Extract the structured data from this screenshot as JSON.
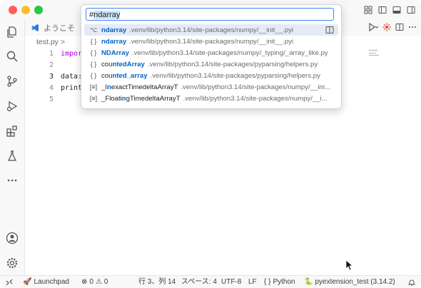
{
  "editor_tabs": [
    {
      "label": "ようこそ",
      "icon": "vscode-logo-icon"
    }
  ],
  "breadcrumb": {
    "file": "test.py",
    "separator": ">"
  },
  "code": {
    "lines": [
      {
        "num": "1",
        "text": "impor"
      },
      {
        "num": "2",
        "text": ""
      },
      {
        "num": "3",
        "text": "data:"
      },
      {
        "num": "4",
        "text": "print"
      },
      {
        "num": "5",
        "text": ""
      }
    ]
  },
  "quick_open": {
    "input": {
      "prefix": "#",
      "selected": "ndarray"
    },
    "results": [
      {
        "icon": "alias-icon",
        "icon_glyph": "⌥",
        "name_pre": "",
        "name_hl": "ndarray",
        "name_post": "",
        "path": ".venv/lib/python3.14/site-packages/numpy/__init__.pyi",
        "selected": true
      },
      {
        "icon": "braces-icon",
        "icon_glyph": "{ }",
        "name_pre": "",
        "name_hl": "ndarray",
        "name_post": "",
        "path": ".venv/lib/python3.14/site-packages/numpy/__init__.pyi",
        "selected": false
      },
      {
        "icon": "braces-icon",
        "icon_glyph": "{ }",
        "name_pre": "",
        "name_hl": "NDArray",
        "name_post": "",
        "path": ".venv/lib/python3.14/site-packages/numpy/_typing/_array_like.py",
        "selected": false
      },
      {
        "icon": "braces-icon",
        "icon_glyph": "{ }",
        "name_pre": "cou",
        "name_hl": "ntedArray",
        "name_post": "",
        "path": ".venv/lib/python3.14/site-packages/pyparsing/helpers.py",
        "selected": false
      },
      {
        "icon": "braces-icon",
        "icon_glyph": "{ }",
        "name_pre": "cou",
        "name_hl": "nted_array",
        "name_post": "",
        "path": ".venv/lib/python3.14/site-packages/pyparsing/helpers.py",
        "selected": false
      },
      {
        "icon": "class-icon",
        "icon_glyph": "[≡]",
        "name_pre": "_I",
        "name_hl": "n",
        "name_post": "exactTimedeltaArrayT",
        "path": ".venv/lib/python3.14/site-packages/numpy/__ini...",
        "selected": false
      },
      {
        "icon": "class-icon",
        "icon_glyph": "[≡]",
        "name_pre": "_Floati",
        "name_hl": "n",
        "name_post": "gTimedeltaArrayT",
        "path": ".venv/lib/python3.14/site-packages/numpy/__i...",
        "selected": false
      }
    ]
  },
  "status_bar": {
    "launchpad": "Launchpad",
    "errors": "0",
    "warnings": "0",
    "position": "行 3、列 14",
    "spaces": "スペース: 4",
    "encoding": "UTF-8",
    "eol": "LF",
    "language": "Python",
    "interpreter": "pyextension_test (3.14.2)"
  },
  "colors": {
    "accent": "#0064c8",
    "titlebar_bg": "#f8f8f8",
    "input_border": "#3b82f6",
    "selected_row": "#e4ebf5"
  }
}
